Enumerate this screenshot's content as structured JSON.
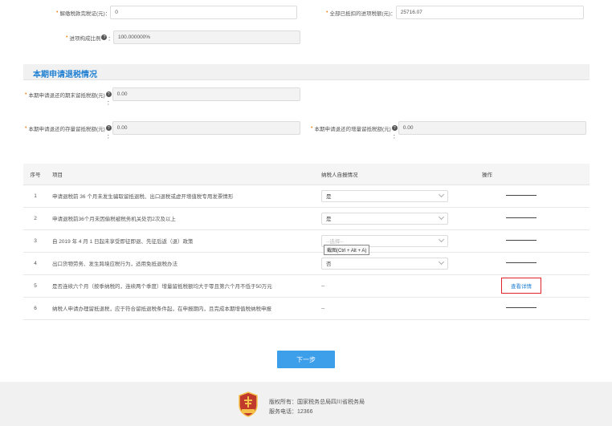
{
  "top_fields": {
    "cert_tax_label": "解缴税款完税证(元)：",
    "cert_tax_value": "0",
    "deducted_input_label": "全部已抵扣的进项税额(元)：",
    "deducted_input_value": "25716.07",
    "ratio_label": "进项构成比例",
    "ratio_colon": "：",
    "ratio_value": "100.000000%"
  },
  "section": {
    "title": "本期申请退税情况",
    "end_label": "本期申请退还的期末留抵税额(元)",
    "end_value": "0.00",
    "stock_label": "本期申请退还的存量留抵税额(元)",
    "stock_value": "0.00",
    "incr_label": "本期申请退还的增量留抵税额(元)",
    "incr_value": "0.00",
    "colon": "："
  },
  "table": {
    "headers": {
      "no": "序号",
      "item": "项目",
      "self": "纳税人自报情况",
      "op": "操作"
    },
    "rows": [
      {
        "no": "1",
        "item": "申请退税前 36 个月未发生骗取留抵退税、出口退税或虚开增值税专用发票情形",
        "self": "是"
      },
      {
        "no": "2",
        "item": "申请退税前36个月未因偷税被税务机关处罚2次及以上",
        "self": "是"
      },
      {
        "no": "3",
        "item": "自 2019 年 4 月 1 日起未享受即征即退、先征后返（退）政策",
        "placeholder": "--选择--",
        "tooltip": "截图(Ctrl + Alt + A)"
      },
      {
        "no": "4",
        "item": "出口货物劳务、发生跨境应税行为，适用免抵退税办法",
        "self": "否"
      },
      {
        "no": "5",
        "item": "是否连续六个月（按季纳税的，连续两个季度）增量留抵税额均大于零且第六个月不低于50万元",
        "self": "--",
        "op": "查看详情"
      },
      {
        "no": "6",
        "item": "纳税人申请办理留抵退税，应于符合留抵退税条件起，在申报期内，且完成本期增值税纳税申报",
        "self": "--"
      }
    ]
  },
  "next_button": "下一步",
  "footer": {
    "copyright": "版权所有：国家税务总局四川省税务局",
    "phone": "服务电话：12366"
  }
}
